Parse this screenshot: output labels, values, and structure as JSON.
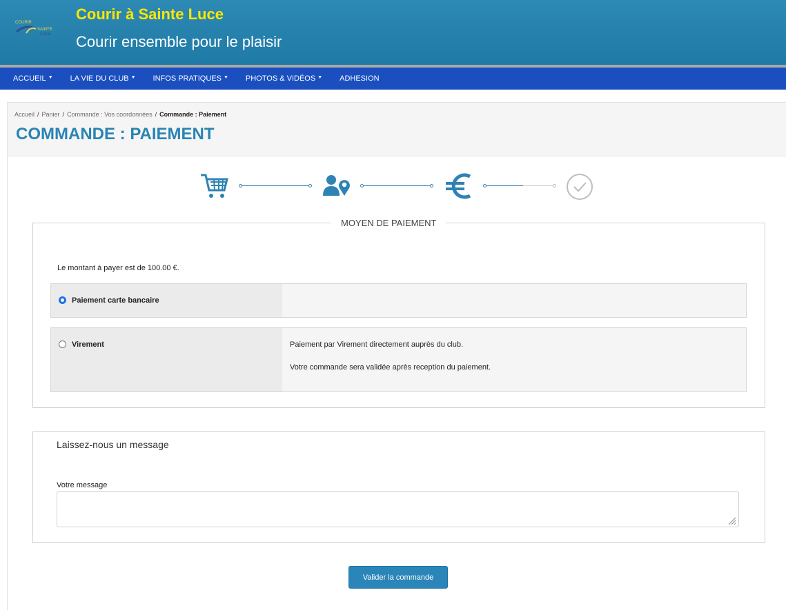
{
  "header": {
    "title": "Courir à Sainte Luce",
    "tagline": "Courir ensemble pour le plaisir",
    "logo_icon": "club-logo-icon"
  },
  "nav": {
    "items": [
      {
        "label": "ACCUEIL",
        "dropdown": true
      },
      {
        "label": "LA VIE DU CLUB",
        "dropdown": true
      },
      {
        "label": "INFOS PRATIQUES",
        "dropdown": true
      },
      {
        "label": "PHOTOS & VIDÉOS",
        "dropdown": true
      },
      {
        "label": "ADHESION",
        "dropdown": false
      }
    ]
  },
  "breadcrumb": {
    "items": [
      "Accueil",
      "Panier",
      "Commande : Vos coordonnées"
    ],
    "current": "Commande : Paiement",
    "separator": "/"
  },
  "page_title": "COMMANDE : PAIEMENT",
  "steps": {
    "icons": [
      "cart-icon",
      "user-location-icon",
      "euro-icon",
      "check-circle-icon"
    ],
    "active_color": "#2f83b4",
    "inactive_color": "#cccccc",
    "progress": 0.75
  },
  "payment": {
    "legend": "MOYEN DE PAIEMENT",
    "amount_text": "Le montant à payer est de 100.00 €.",
    "options": [
      {
        "label": "Paiement carte bancaire",
        "selected": true,
        "descriptions": []
      },
      {
        "label": "Virement",
        "selected": false,
        "descriptions": [
          "Paiement par Virement directement auprès du club.",
          "Votre commande sera validée après reception du paiement."
        ]
      }
    ]
  },
  "message": {
    "title": "Laissez-nous un message",
    "label": "Votre message",
    "value": ""
  },
  "submit_label": "Valider la commande",
  "colors": {
    "header_bg": "#2186b2",
    "title_yellow": "#ffe600",
    "nav_bg": "#1b4fc0",
    "accent": "#2a84b4"
  }
}
